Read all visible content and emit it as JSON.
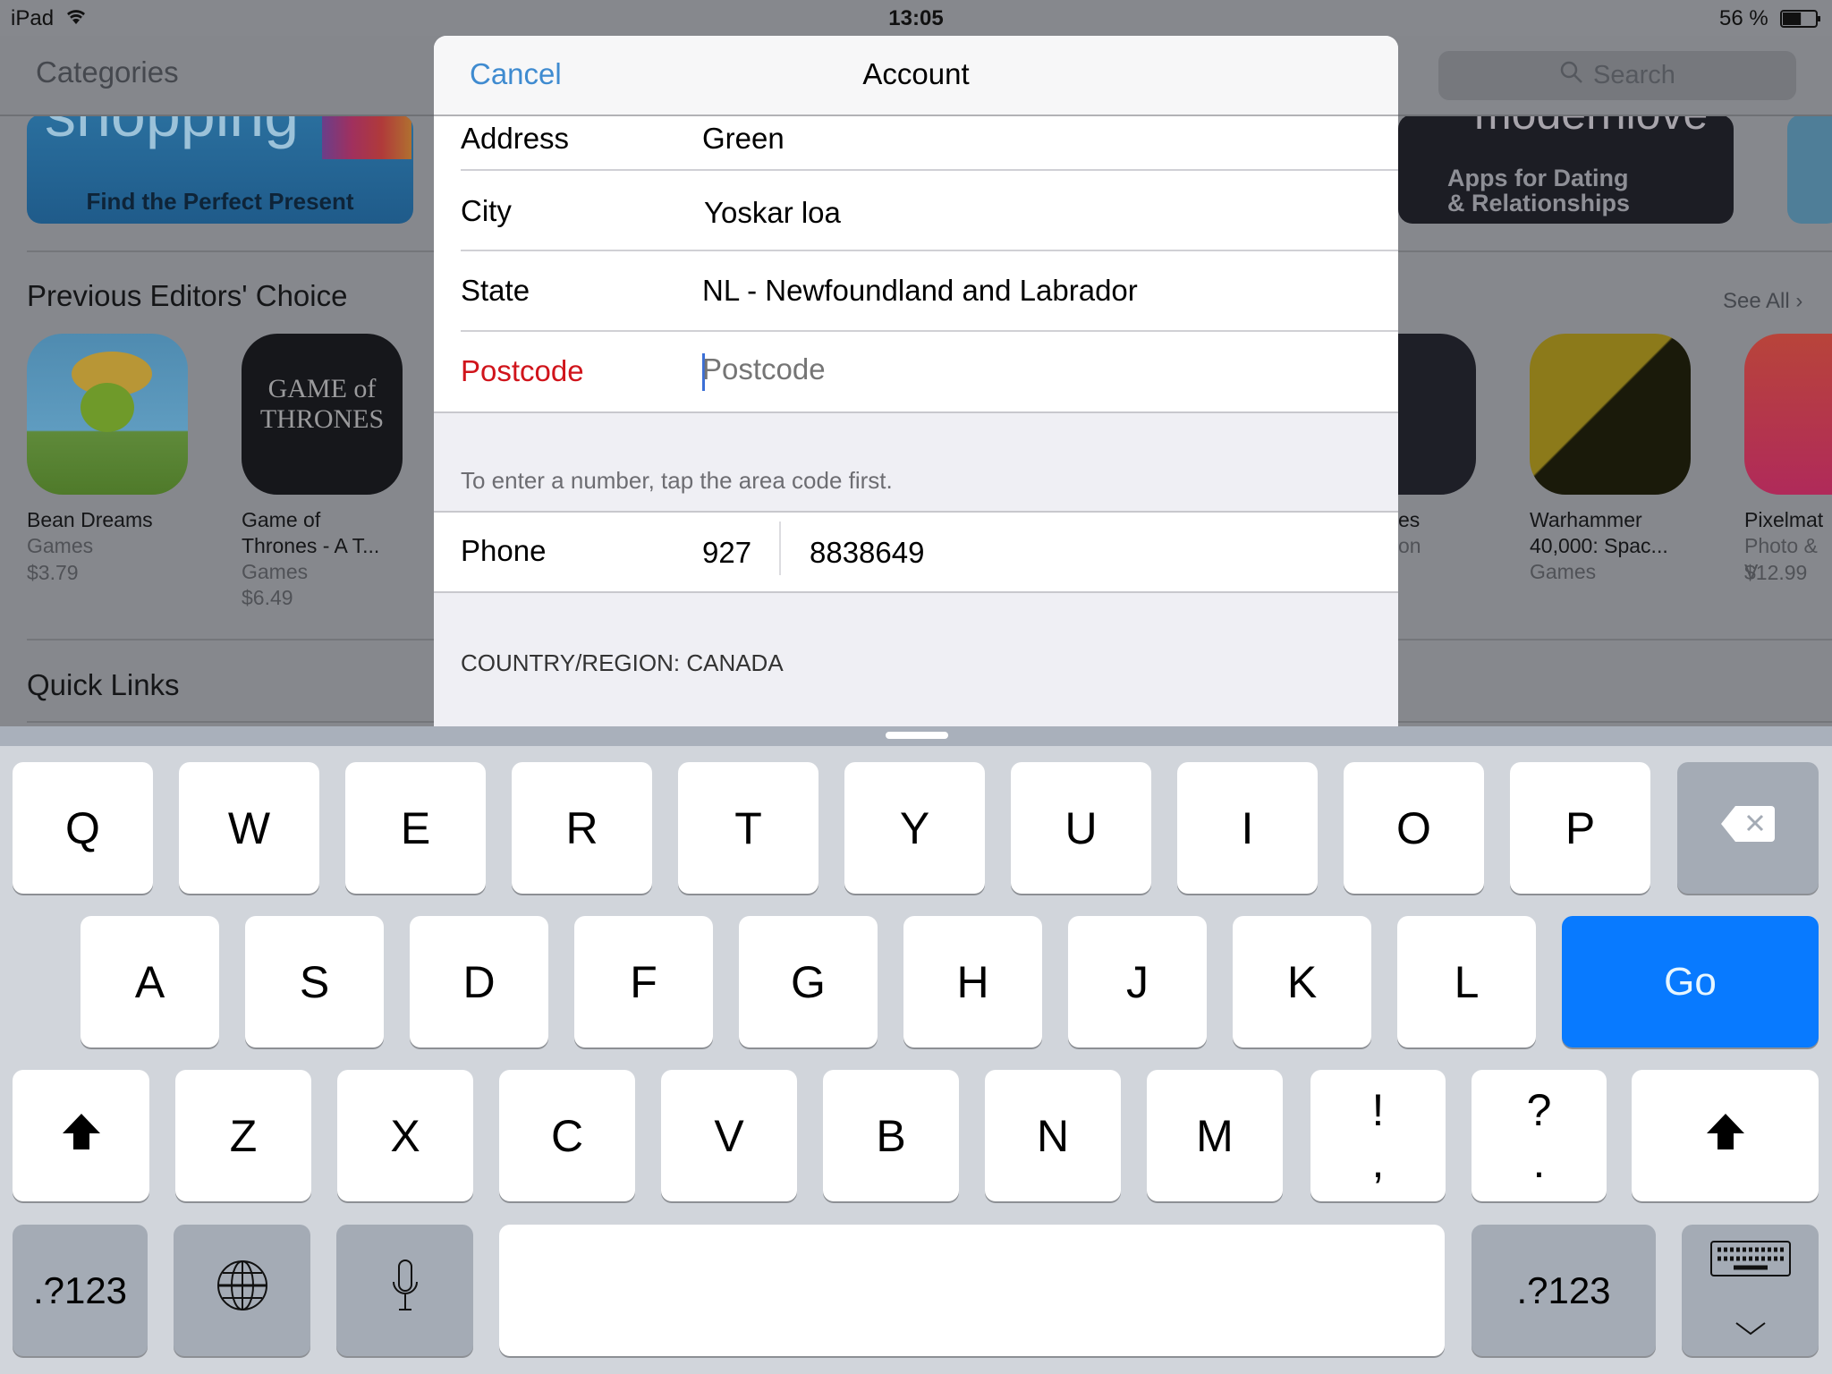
{
  "status_bar": {
    "device": "iPad",
    "time": "13:05",
    "battery": "56 %",
    "battery_level": 0.56
  },
  "background_app": {
    "nav_title": "Categories",
    "search_placeholder": "Search",
    "banners": [
      {
        "text_top": "shopping",
        "text": "Find the Perfect Present"
      },
      {
        "text_top": "modernlove",
        "text": "Apps for Dating & Relationships",
        "line1": "Apps for Dating",
        "line2": "& Relationships"
      }
    ],
    "section_title": "Previous Editors' Choice",
    "see_all": "See All",
    "apps": [
      {
        "name_line1": "Bean Dreams",
        "name_line2": "",
        "category": "Games",
        "price": "$3.79"
      },
      {
        "name_line1": "Game of",
        "name_line2": "Thrones - A T...",
        "category": "Games",
        "price": "$6.49"
      },
      {
        "name_line1": "...es",
        "name_line2": "",
        "category": "...on",
        "price": ""
      },
      {
        "name_line1": "Warhammer",
        "name_line2": "40,000: Spac...",
        "category": "Games",
        "price": ""
      },
      {
        "name_line1": "Pixelmat...",
        "name_line2": "",
        "category": "Photo & V...",
        "price": "$12.99"
      }
    ],
    "quick_links": "Quick Links"
  },
  "modal": {
    "cancel_label": "Cancel",
    "title": "Account",
    "fields": [
      {
        "label": "Address",
        "value": "Green"
      },
      {
        "label": "City",
        "value": "Yoskar loa"
      },
      {
        "label": "State",
        "value": "NL - Newfoundland and Labrador"
      }
    ],
    "postcode": {
      "label": "Postcode",
      "value": "",
      "placeholder": "Postcode",
      "error_color": "#d0141b"
    },
    "phone_hint": "To enter a number, tap the area code first.",
    "phone": {
      "label": "Phone",
      "area_code": "927",
      "number": "8838649"
    },
    "country": "COUNTRY/REGION: CANADA"
  },
  "keyboard": {
    "row1": [
      "Q",
      "W",
      "E",
      "R",
      "T",
      "Y",
      "U",
      "I",
      "O",
      "P"
    ],
    "row2": [
      "A",
      "S",
      "D",
      "F",
      "G",
      "H",
      "J",
      "K",
      "L"
    ],
    "row3": [
      "Z",
      "X",
      "C",
      "V",
      "B",
      "N",
      "M"
    ],
    "row3_punct": [
      {
        "top": "!",
        "bottom": ","
      },
      {
        "top": "?",
        "bottom": "."
      }
    ],
    "go_label": "Go",
    "numbers_label": ".?123",
    "accent_color": "#087aff"
  }
}
